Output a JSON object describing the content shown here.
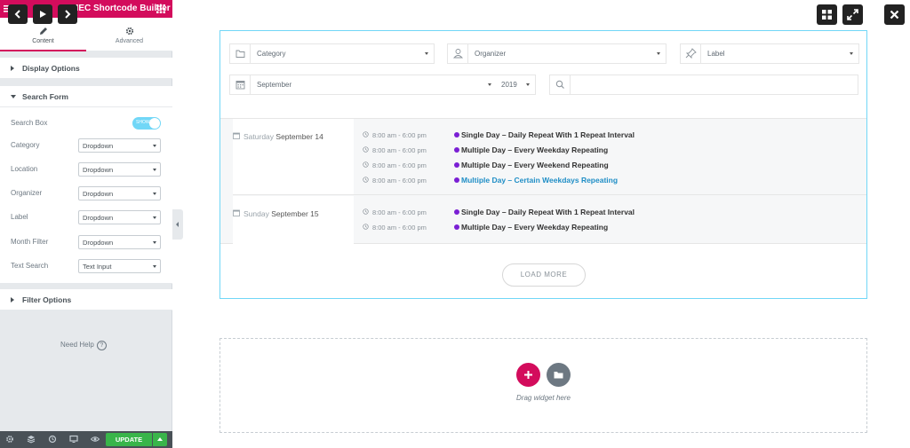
{
  "sidebar": {
    "header_title": "MEC Shortcode Builder",
    "tabs": [
      {
        "label": "Content",
        "icon": "pencil-icon"
      },
      {
        "label": "Advanced",
        "icon": "gear-icon"
      }
    ],
    "sections": {
      "display_options": "Display Options",
      "search_form": "Search Form",
      "filter_options": "Filter Options"
    },
    "search_form": {
      "search_box_label": "Search Box",
      "search_box_toggle": "SHOW",
      "rows": [
        {
          "label": "Category",
          "value": "Dropdown"
        },
        {
          "label": "Location",
          "value": "Dropdown"
        },
        {
          "label": "Organizer",
          "value": "Dropdown"
        },
        {
          "label": "Label",
          "value": "Dropdown"
        },
        {
          "label": "Month Filter",
          "value": "Dropdown"
        },
        {
          "label": "Text Search",
          "value": "Text Input"
        }
      ]
    },
    "need_help": "Need Help",
    "footer": {
      "update_label": "UPDATE"
    }
  },
  "widget": {
    "search": {
      "category": "Category",
      "organizer": "Organizer",
      "label": "Label",
      "month": "September",
      "year": "2019",
      "text_search": ""
    },
    "days": [
      {
        "weekday": "Saturday",
        "date": "September 14",
        "events": [
          {
            "time": "8:00 am - 6:00 pm",
            "title": "Single Day – Daily Repeat With 1 Repeat Interval",
            "link": false
          },
          {
            "time": "8:00 am - 6:00 pm",
            "title": "Multiple Day – Every Weekday Repeating",
            "link": false
          },
          {
            "time": "8:00 am - 6:00 pm",
            "title": "Multiple Day – Every Weekend Repeating",
            "link": false
          },
          {
            "time": "8:00 am - 6:00 pm",
            "title": "Multiple Day – Certain Weekdays Repeating",
            "link": true
          }
        ]
      },
      {
        "weekday": "Sunday",
        "date": "September 15",
        "events": [
          {
            "time": "8:00 am - 6:00 pm",
            "title": "Single Day – Daily Repeat With 1 Repeat Interval",
            "link": false
          },
          {
            "time": "8:00 am - 6:00 pm",
            "title": "Multiple Day – Every Weekday Repeating",
            "link": false
          }
        ]
      }
    ],
    "load_more": "LOAD MORE",
    "dot_color": "#7a1fd4",
    "link_color": "#1f8ec6"
  },
  "drop_zone": {
    "text": "Drag widget here"
  },
  "colors": {
    "brand": "#d30c5c",
    "update": "#39b54a",
    "selection_border": "#71d7f7"
  }
}
